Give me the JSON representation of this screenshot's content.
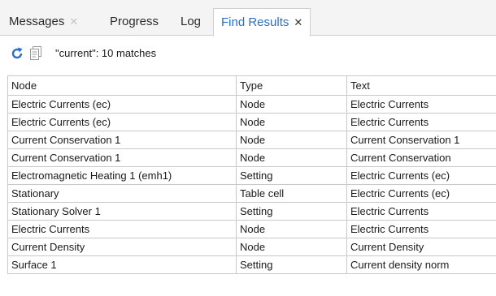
{
  "tabs": [
    {
      "label": "Messages",
      "close": "✕"
    },
    {
      "label": "Progress"
    },
    {
      "label": "Log"
    },
    {
      "label": "Find Results",
      "close": "✕"
    }
  ],
  "toolbar": {
    "refresh_icon": "refresh-icon",
    "copy_icon": "copy-icon",
    "status": "\"current\": 10 matches"
  },
  "table": {
    "headers": [
      "Node",
      "Type",
      "Text"
    ],
    "rows": [
      [
        "Electric Currents (ec)",
        "Node",
        "Electric Currents"
      ],
      [
        "Electric Currents (ec)",
        "Node",
        "Electric Currents"
      ],
      [
        "Current Conservation 1",
        "Node",
        "Current Conservation 1"
      ],
      [
        "Current Conservation 1",
        "Node",
        "Current Conservation"
      ],
      [
        "Electromagnetic Heating 1 (emh1)",
        "Setting",
        "Electric Currents (ec)"
      ],
      [
        "Stationary",
        "Table cell",
        "Electric Currents (ec)"
      ],
      [
        "Stationary Solver 1",
        "Setting",
        "Electric Currents"
      ],
      [
        "Electric Currents",
        "Node",
        "Electric Currents"
      ],
      [
        "Current Density",
        "Node",
        "Current Density"
      ],
      [
        "Surface 1",
        "Setting",
        "Current density norm"
      ]
    ]
  },
  "colors": {
    "active_tab": "#2a6fc9",
    "refresh": "#2a6fc9"
  }
}
